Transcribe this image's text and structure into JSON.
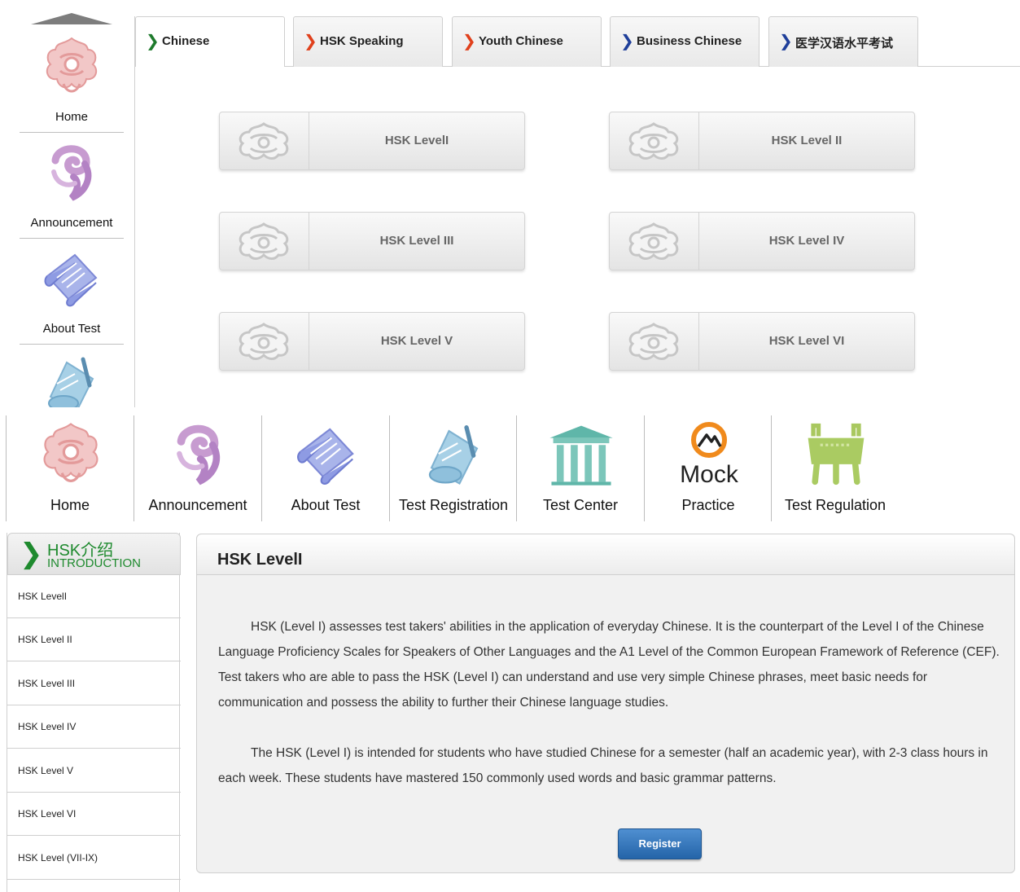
{
  "top_sidebar": {
    "items": [
      {
        "label": "Home",
        "icon": "cloud-knot-icon"
      },
      {
        "label": "Announcement",
        "icon": "swirl-icon"
      },
      {
        "label": "About Test",
        "icon": "scroll-icon"
      },
      {
        "label": "",
        "icon": "registration-icon"
      }
    ]
  },
  "tabs": [
    {
      "label": "Chinese",
      "chevron_color": "#1e7a2c"
    },
    {
      "label": "HSK Speaking",
      "chevron_color": "#e0401c"
    },
    {
      "label": "Youth Chinese",
      "chevron_color": "#e0401c"
    },
    {
      "label": "Business Chinese",
      "chevron_color": "#1f3f9a"
    },
    {
      "label": "医学汉语水平考试",
      "chevron_color": "#1f3f9a"
    }
  ],
  "level_buttons": [
    {
      "label": "HSK LevelI"
    },
    {
      "label": "HSK Level II"
    },
    {
      "label": "HSK Level III"
    },
    {
      "label": "HSK Level IV"
    },
    {
      "label": "HSK Level V"
    },
    {
      "label": "HSK Level VI"
    }
  ],
  "main_nav": {
    "items": [
      {
        "label": "Home",
        "icon": "cloud-knot-icon"
      },
      {
        "label": "Announcement",
        "icon": "swirl-icon"
      },
      {
        "label": "About Test",
        "icon": "scroll-icon"
      },
      {
        "label": "Test Registration",
        "icon": "registration-icon"
      },
      {
        "label": "Test Center",
        "icon": "gate-icon"
      },
      {
        "label": "Practice",
        "icon": "mock-icon",
        "logo_text": "Mock"
      },
      {
        "label": "Test Regulation",
        "icon": "ding-vessel-icon"
      }
    ]
  },
  "intro": {
    "title_cn": "HSK介绍",
    "title_en": "INTRODUCTION",
    "items": [
      {
        "label": "HSK LevelI"
      },
      {
        "label": "HSK Level II"
      },
      {
        "label": "HSK Level III"
      },
      {
        "label": "HSK Level IV"
      },
      {
        "label": "HSK Level V"
      },
      {
        "label": "HSK Level VI"
      },
      {
        "label": "HSK Level (VII-IX)"
      }
    ]
  },
  "content": {
    "title": "HSK LevelI",
    "paragraphs": [
      "HSK (Level I) assesses test takers' abilities in the application of everyday Chinese. It is the counterpart of the Level I of the Chinese Language Proficiency Scales for Speakers of Other Languages and the A1 Level of the Common European Framework of Reference (CEF). Test takers who are able to pass the HSK (Level I) can understand and use very simple Chinese phrases, meet basic needs for communication and possess the ability to further their Chinese language studies.",
      "The HSK (Level I) is intended for students who have studied Chinese for a semester (half an academic year), with 2-3 class hours in each week. These students have mastered 150 commonly used words and basic grammar patterns."
    ],
    "register_label": "Register"
  },
  "colors": {
    "intro_green": "#1e8a2e",
    "register_blue": "#2f74bd"
  }
}
